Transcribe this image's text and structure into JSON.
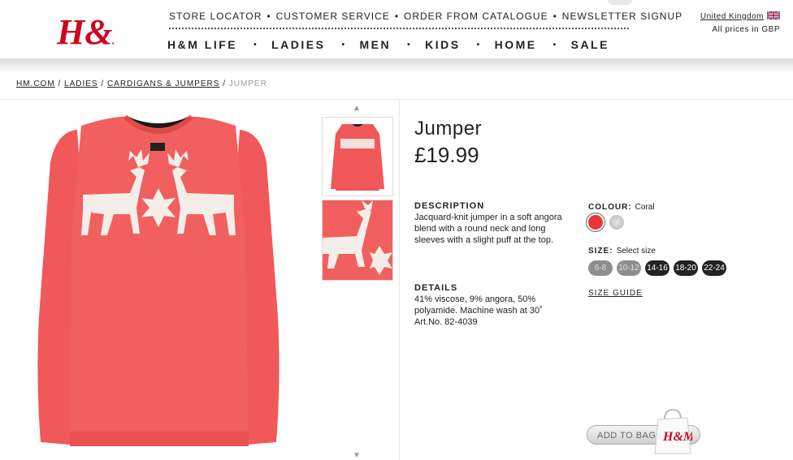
{
  "brand": {
    "logo_text": "H&M",
    "color": "#cc071e"
  },
  "utility_nav": [
    "STORE LOCATOR",
    "CUSTOMER SERVICE",
    "ORDER FROM CATALOGUE",
    "NEWSLETTER SIGNUP"
  ],
  "utility_sep": "•",
  "main_nav": [
    "H&M LIFE",
    "LADIES",
    "MEN",
    "KIDS",
    "HOME",
    "SALE"
  ],
  "region": {
    "country": "United Kingdom",
    "currency_note": "All prices in GBP"
  },
  "breadcrumb": {
    "items": [
      "HM.COM",
      "LADIES",
      "CARDIGANS & JUMPERS"
    ],
    "separator": "/",
    "current": "JUMPER"
  },
  "product": {
    "title": "Jumper",
    "price": "£19.99",
    "description_heading": "DESCRIPTION",
    "description": "Jacquard-knit jumper in a soft angora blend with a round neck and long sleeves with a slight puff at the top.",
    "details_heading": "DETAILS",
    "details_composition": "41% viscose, 9% angora, 50% polyamide. Machine wash at 30˚",
    "details_artno": "Art.No. 82-4039",
    "colour_heading": "COLOUR:",
    "colour_value": "Coral",
    "colours": [
      {
        "hex": "#e8353b",
        "selected": true
      },
      {
        "hex": "#c8c8c8",
        "selected": false
      }
    ],
    "size_heading": "SIZE:",
    "size_hint": "Select size",
    "sizes": [
      {
        "label": "6-8",
        "available": false
      },
      {
        "label": "10-12",
        "available": false
      },
      {
        "label": "14-16",
        "available": true
      },
      {
        "label": "18-20",
        "available": true
      },
      {
        "label": "22-24",
        "available": true
      }
    ],
    "size_guide": "SIZE GUIDE",
    "add_to_bag": "ADD TO BAG",
    "garment_color": "#f0585a",
    "pattern_color": "#f5eee8"
  }
}
